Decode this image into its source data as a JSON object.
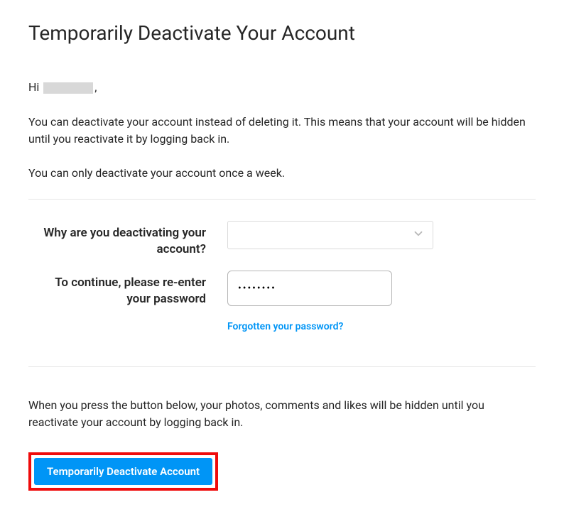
{
  "header": {
    "title": "Temporarily Deactivate Your Account"
  },
  "greeting": {
    "prefix": "Hi ",
    "suffix": ","
  },
  "intro": {
    "p1": "You can deactivate your account instead of deleting it. This means that your account will be hidden until you reactivate it by logging back in.",
    "p2": "You can only deactivate your account once a week."
  },
  "form": {
    "reason_label": "Why are you deactivating your account?",
    "password_label": "To continue, please re-enter your password",
    "reason_value": "",
    "password_value": "••••••••",
    "forgot_link": "Forgotten your password?"
  },
  "footer": {
    "note": "When you press the button below, your photos, comments and likes will be hidden until you reactivate your account by logging back in.",
    "button": "Temporarily Deactivate Account"
  }
}
